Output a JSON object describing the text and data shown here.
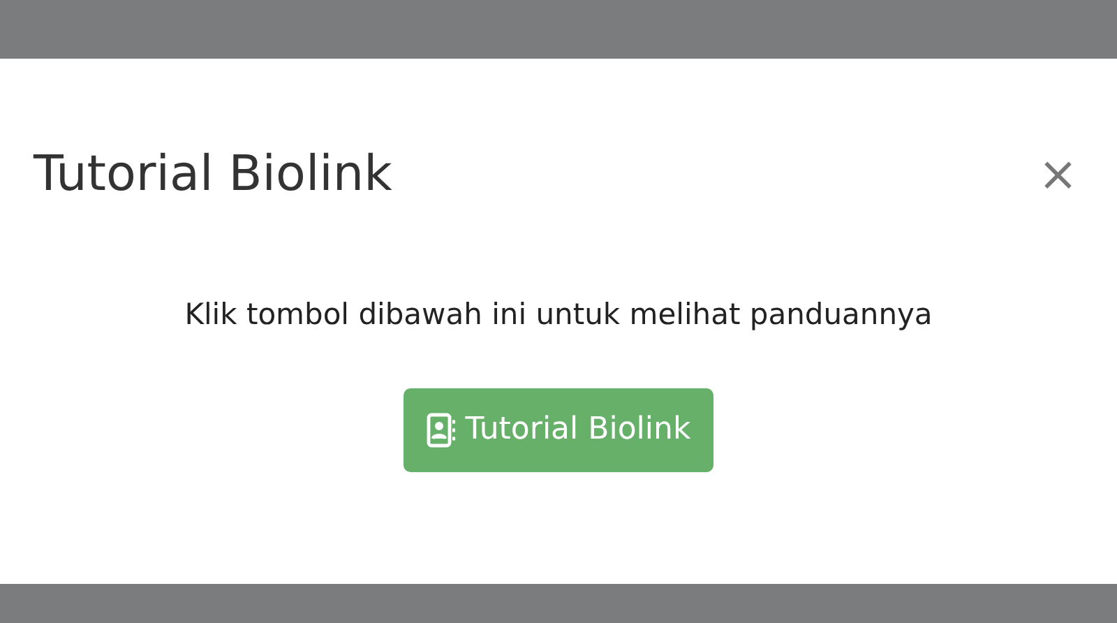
{
  "modal": {
    "title": "Tutorial Biolink",
    "close": "×",
    "message": "Klik tombol dibawah ini untuk melihat panduannya",
    "button": {
      "label": "Tutorial Biolink"
    }
  }
}
